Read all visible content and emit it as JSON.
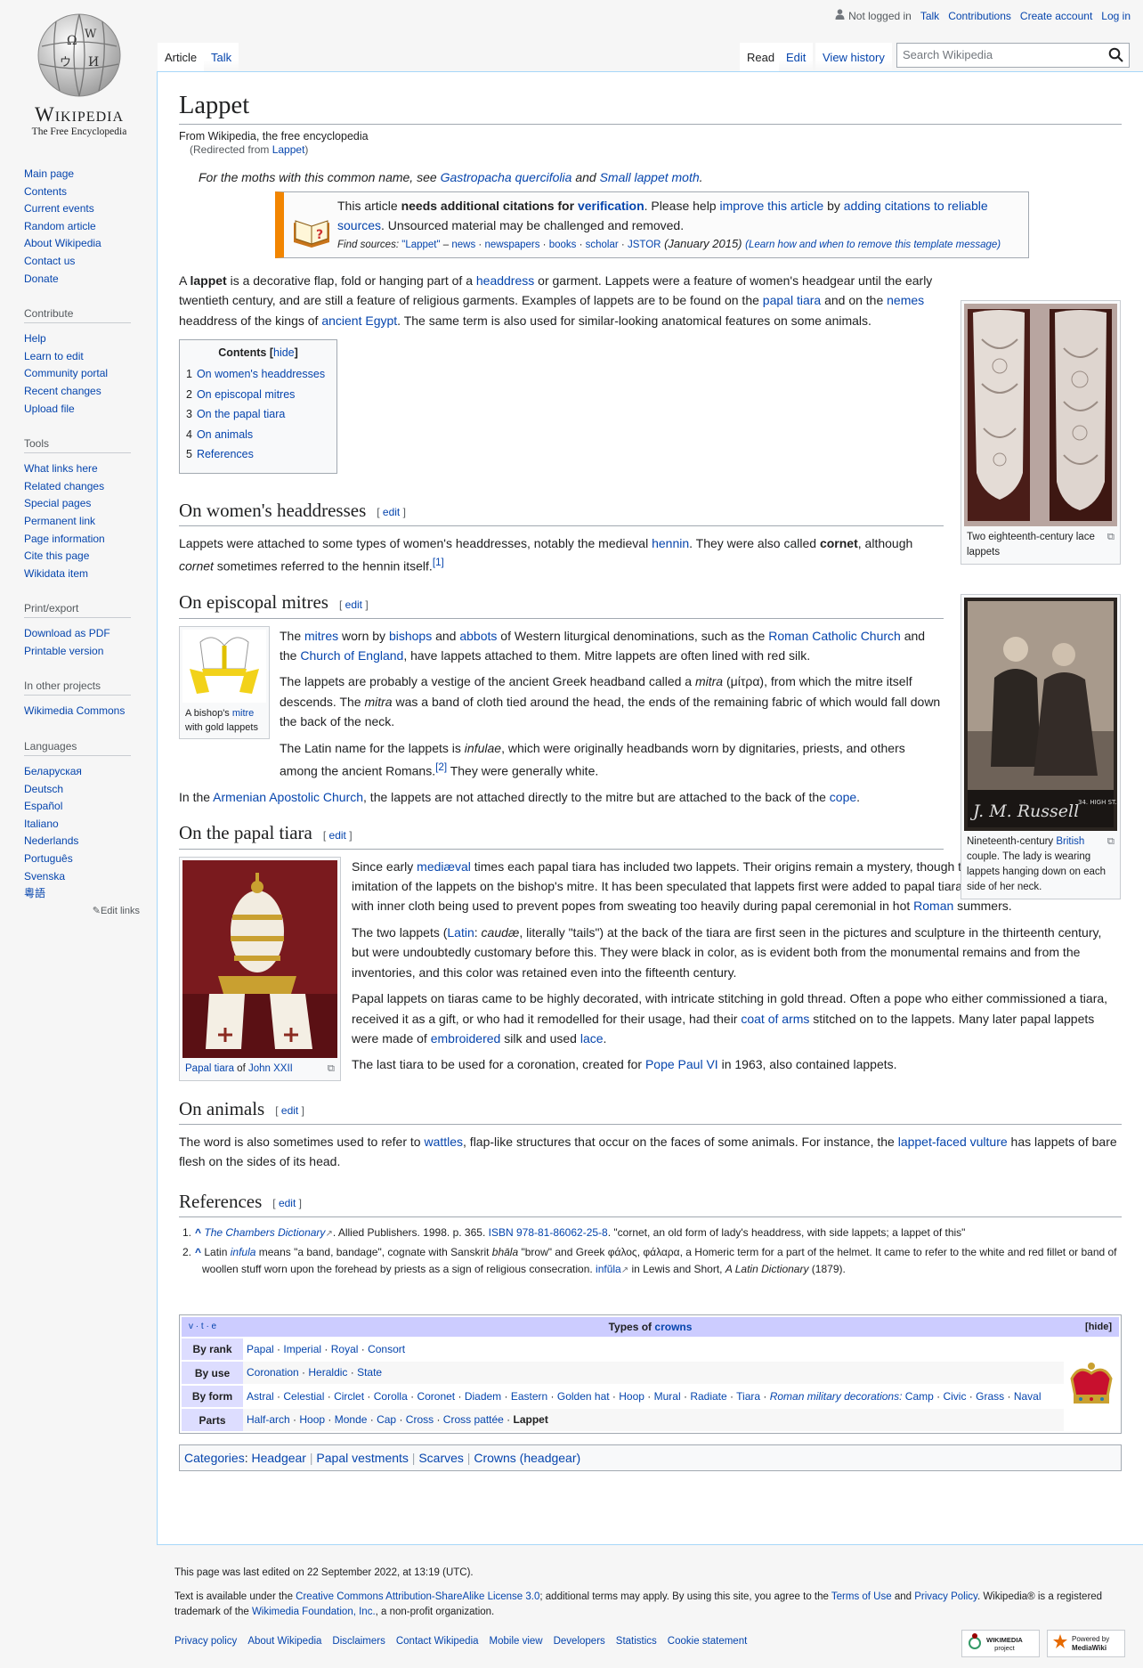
{
  "personal": {
    "not_logged": "Not logged in",
    "talk": "Talk",
    "contributions": "Contributions",
    "create": "Create account",
    "login": "Log in"
  },
  "logo": {
    "word": "Wikipedia",
    "tag": "The Free Encyclopedia"
  },
  "tabs": {
    "article": "Article",
    "talk": "Talk",
    "read": "Read",
    "edit": "Edit",
    "history": "View history"
  },
  "search": {
    "placeholder": "Search Wikipedia"
  },
  "nav": {
    "main": [
      "Main page",
      "Contents",
      "Current events",
      "Random article",
      "About Wikipedia",
      "Contact us",
      "Donate"
    ],
    "contribute": {
      "title": "Contribute",
      "items": [
        "Help",
        "Learn to edit",
        "Community portal",
        "Recent changes",
        "Upload file"
      ]
    },
    "tools": {
      "title": "Tools",
      "items": [
        "What links here",
        "Related changes",
        "Special pages",
        "Permanent link",
        "Page information",
        "Cite this page",
        "Wikidata item"
      ]
    },
    "print": {
      "title": "Print/export",
      "items": [
        "Download as PDF",
        "Printable version"
      ]
    },
    "projects": {
      "title": "In other projects",
      "items": [
        "Wikimedia Commons"
      ]
    },
    "langs": {
      "title": "Languages",
      "items": [
        "Беларуская",
        "Deutsch",
        "Español",
        "Italiano",
        "Nederlands",
        "Português",
        "Svenska",
        "粵語"
      ],
      "edit": "Edit links"
    }
  },
  "page": {
    "title": "Lappet",
    "from": "From Wikipedia, the free encyclopedia",
    "redir_pre": "(Redirected from ",
    "redir_link": "Lappet",
    "redir_post": ")"
  },
  "hatnote": {
    "pre": "For the moths with this common name, see ",
    "l1": "Gastropacha quercifolia",
    "mid": " and ",
    "l2": "Small lappet moth",
    "post": "."
  },
  "ambox": {
    "t1": "This article ",
    "t2": "needs additional citations for ",
    "t3": "verification",
    "t4": ". Please help ",
    "t5": "improve this article",
    "t6": " by ",
    "t7": "adding citations to reliable sources",
    "t8": ". Unsourced material may be challenged and removed.",
    "fs": "Find sources:",
    "q": "\"Lappet\"",
    "dash": " – ",
    "news": "news",
    "np": "newspapers",
    "books": "books",
    "scholar": "scholar",
    "jstor": "JSTOR",
    "date": " (January 2015) ",
    "learn": "(Learn how and when to remove this template message)"
  },
  "lead": {
    "a": "A ",
    "b": "lappet",
    "c": " is a decorative flap, fold or hanging part of a ",
    "d": "headdress",
    "e": " or garment. Lappets were a feature of women's headgear until the early twentieth century, and are still a feature of religious garments. Examples of lappets are to be found on the ",
    "f": "papal tiara",
    "g": " and on the ",
    "h": "nemes",
    "i": " headdress of the kings of ",
    "j": "ancient Egypt",
    "k": ". The same term is also used for similar-looking anatomical features on some animals."
  },
  "toc": {
    "title": "Contents",
    "hide": "hide",
    "items": [
      {
        "n": "1",
        "t": "On women's headdresses"
      },
      {
        "n": "2",
        "t": "On episcopal mitres"
      },
      {
        "n": "3",
        "t": "On the papal tiara"
      },
      {
        "n": "4",
        "t": "On animals"
      },
      {
        "n": "5",
        "t": "References"
      }
    ]
  },
  "edit_label": "edit",
  "s1": {
    "h": "On women's headdresses",
    "a": "Lappets were attached to some types of women's headdresses, notably the medieval ",
    "b": "hennin",
    "c": ". They were also called ",
    "d": "cornet",
    "e": ", although ",
    "f": "cornet",
    "g": " sometimes referred to the hennin itself.",
    "ref": "[1]"
  },
  "s2": {
    "h": "On episcopal mitres",
    "p1a": "The ",
    "p1b": "mitres",
    "p1c": " worn by ",
    "p1d": "bishops",
    "p1e": " and ",
    "p1f": "abbots",
    "p1g": " of Western liturgical denominations, such as the ",
    "p1h": "Roman Catholic Church",
    "p1i": " and the ",
    "p1j": "Church of England",
    "p1k": ", have lappets attached to them. Mitre lappets are often lined with red silk.",
    "p2a": "The lappets are probably a vestige of the ancient Greek headband called a ",
    "p2b": "mitra",
    "p2c": " (μίτρα), from which the mitre itself descends. The ",
    "p2d": "mitra",
    "p2e": " was a band of cloth tied around the head, the ends of the remaining fabric of which would fall down the back of the neck.",
    "p3a": "The Latin name for the lappets is ",
    "p3b": "infulae",
    "p3c": ", which were originally headbands worn by dignitaries, priests, and others among the ancient Romans.",
    "p3ref": "[2]",
    "p3d": " They were generally white.",
    "p4a": "In the ",
    "p4b": "Armenian Apostolic Church",
    "p4c": ", the lappets are not attached directly to the mitre but are attached to the back of the ",
    "p4d": "cope",
    "p4e": ".",
    "cap_a": "A bishop's ",
    "cap_b": "mitre",
    "cap_c": " with gold lappets"
  },
  "s3": {
    "h": "On the papal tiara",
    "p1a": "Since early ",
    "p1b": "mediæval",
    "p1c": " times each papal tiara has included two lappets. Their origins remain a mystery, though they are obviously an imitation of the lappets on the bishop's mitre. It has been speculated that lappets first were added to papal tiaras as a form of sweatband, with inner cloth being used to prevent popes from sweating too heavily during papal ceremonial in hot ",
    "p1d": "Roman",
    "p1e": " summers.",
    "p2a": "The two lappets (",
    "p2b": "Latin",
    "p2c": ": ",
    "p2d": "caudæ",
    "p2e": ", literally \"tails\") at the back of the tiara are first seen in the pictures and sculpture in the thirteenth century, but were undoubtedly customary before this. They were black in color, as is evident both from the monumental remains and from the inventories, and this color was retained even into the fifteenth century.",
    "p3a": "Papal lappets on tiaras came to be highly decorated, with intricate stitching in gold thread. Often a pope who either commissioned a tiara, received it as a gift, or who had it remodelled for their usage, had their ",
    "p3b": "coat of arms",
    "p3c": " stitched on to the lappets. Many later papal lappets were made of ",
    "p3d": "embroidered",
    "p3e": " silk and used ",
    "p3f": "lace",
    "p3g": ".",
    "p4a": "The last tiara to be used for a coronation, created for ",
    "p4b": "Pope Paul VI",
    "p4c": " in 1963, also contained lappets.",
    "cap_a": "Papal tiara",
    "cap_b": " of ",
    "cap_c": "John XXII"
  },
  "s4": {
    "h": "On animals",
    "a": "The word is also sometimes used to refer to ",
    "b": "wattles",
    "c": ", flap-like structures that occur on the faces of some animals. For instance, the ",
    "d": "lappet-faced vulture",
    "e": " has lappets of bare flesh on the sides of its head."
  },
  "s5": {
    "h": "References",
    "r1": {
      "n": "1.",
      "c": "^",
      "a": "The Chambers Dictionary",
      "b": ". Allied Publishers. 1998. p. 365. ",
      "c2": "ISBN",
      "d": " ",
      "e": "978-81-86062-25-8",
      "f": ". \"cornet, an old form of lady's headdress, with side lappets; a lappet of this\""
    },
    "r2": {
      "n": "2.",
      "c": "^",
      "a": " Latin ",
      "b": "infula",
      "c2": " means \"a band, bandage\", cognate with Sanskrit ",
      "d": "bhāla",
      "e": " \"brow\" and Greek φάλος, φάλαρα, a Homeric term for a part of the helmet. It came to refer to the white and red fillet or band of woollen stuff worn upon the forehead by priests as a sign of religious consecration. ",
      "f": "infŭla",
      "g": " in Lewis and Short, ",
      "h": "A Latin Dictionary",
      "i": " (1879)."
    }
  },
  "figs": {
    "lace_cap": "Two eighteenth-century lace lappets",
    "photo_cap_a": "Nineteenth-century ",
    "photo_cap_b": "British",
    "photo_cap_c": " couple. The lady is wearing lappets hanging down on each side of her neck.",
    "photo_sign": "J. M. Russell",
    "photo_addr": "34. HIGH ST."
  },
  "navbox": {
    "vte": "v · t · e",
    "title_a": "Types of ",
    "title_b": "crowns",
    "hide": "[hide]",
    "rows": [
      {
        "g": "By rank",
        "items": [
          "Papal",
          "Imperial",
          "Royal",
          "Consort"
        ]
      },
      {
        "g": "By use",
        "items": [
          "Coronation",
          "Heraldic",
          "State"
        ]
      },
      {
        "g": "By form",
        "items": [
          "Astral",
          "Celestial",
          "Circlet",
          "Corolla",
          "Coronet",
          "Diadem",
          "Eastern",
          "Golden hat",
          "Hoop",
          "Mural",
          "Radiate",
          "Tiara"
        ],
        "sub": "Roman military decorations:",
        "items2": [
          "Camp",
          "Civic",
          "Grass",
          "Naval"
        ]
      },
      {
        "g": "Parts",
        "items": [
          "Half-arch",
          "Hoop",
          "Monde",
          "Cap",
          "Cross",
          "Cross pattée"
        ],
        "self": "Lappet"
      }
    ]
  },
  "categories": {
    "label": "Categories",
    "items": [
      "Headgear",
      "Papal vestments",
      "Scarves",
      "Crowns (headgear)"
    ]
  },
  "footer": {
    "edited": "This page was last edited on 22 September 2022, at 13:19 (UTC).",
    "lic_a": "Text is available under the ",
    "lic_b": "Creative Commons Attribution-ShareAlike License 3.0",
    "lic_c": "; additional terms may apply. By using this site, you agree to the ",
    "lic_d": "Terms of Use",
    "lic_e": " and ",
    "lic_f": "Privacy Policy",
    "lic_g": ". Wikipedia® is a registered trademark of the ",
    "lic_h": "Wikimedia Foundation, Inc.",
    "lic_i": ", a non-profit organization.",
    "links": [
      "Privacy policy",
      "About Wikipedia",
      "Disclaimers",
      "Contact Wikipedia",
      "Mobile view",
      "Developers",
      "Statistics",
      "Cookie statement"
    ],
    "wm_a": "WIKIMEDIA",
    "wm_b": "project",
    "pw_a": "Powered by",
    "pw_b": "MediaWiki"
  }
}
